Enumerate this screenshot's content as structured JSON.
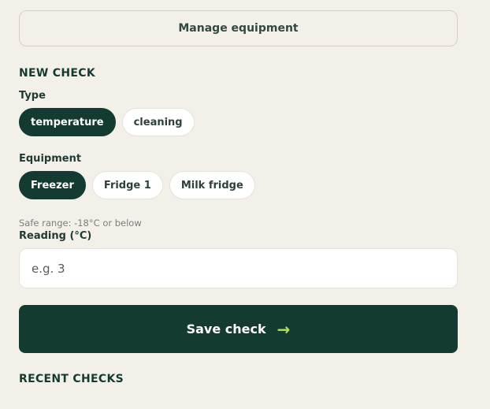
{
  "manage_button": "Manage equipment",
  "new_check": {
    "title": "NEW CHECK",
    "type_label": "Type",
    "types": [
      "temperature",
      "cleaning"
    ],
    "selected_type": "temperature",
    "equipment_label": "Equipment",
    "equipment": [
      "Freezer",
      "Fridge 1",
      "Milk fridge"
    ],
    "selected_equipment": "Freezer",
    "safe_range": "Safe range: -18°C or below",
    "reading_label": "Reading (°C)",
    "reading_placeholder": "e.g. 3",
    "reading_value": "",
    "save_label": "Save check",
    "save_icon": "arrow-right-icon"
  },
  "recent_checks": {
    "title": "RECENT CHECKS"
  },
  "colors": {
    "background": "#f3efe9",
    "primary": "#143b31",
    "accent": "#b6e04a"
  }
}
